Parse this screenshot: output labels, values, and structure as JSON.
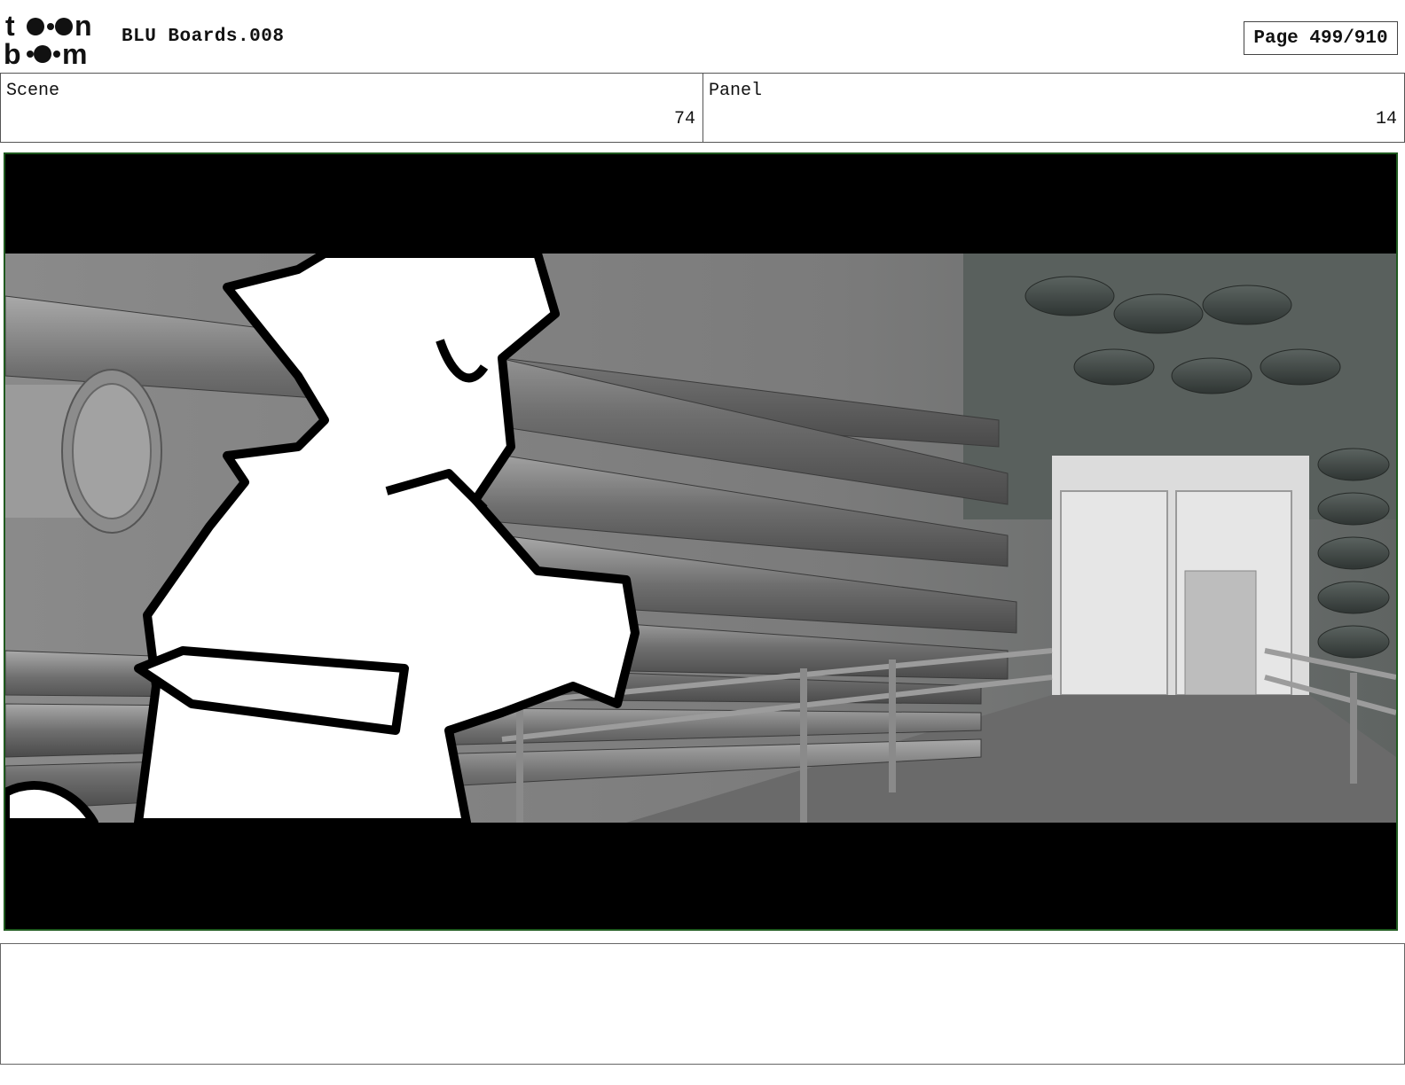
{
  "header": {
    "logo_text": "toonboom",
    "doc_title": "BLU Boards.008",
    "page_label": "Page 499/910"
  },
  "scene": {
    "label": "Scene",
    "value": "74"
  },
  "panel": {
    "label": "Panel",
    "value": "14"
  },
  "frame": {
    "description_hidden": ""
  },
  "notes": {
    "text": ""
  },
  "colors": {
    "frame_border": "#1f5a1f",
    "letterbox": "#000000"
  }
}
